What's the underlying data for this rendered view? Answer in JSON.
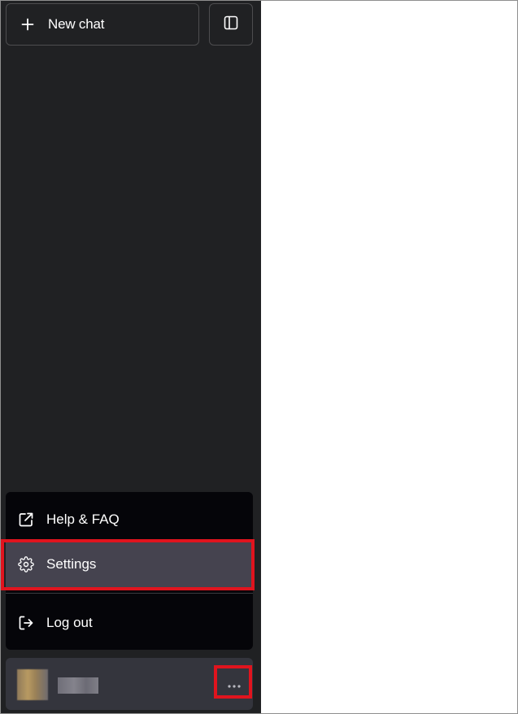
{
  "sidebar": {
    "new_chat_label": "New chat",
    "background_color": "#202123"
  },
  "menu": {
    "items": [
      {
        "label": "Help & FAQ",
        "icon": "external-link-icon"
      },
      {
        "label": "Settings",
        "icon": "gear-icon",
        "highlighted": true
      },
      {
        "label": "Log out",
        "icon": "logout-icon"
      }
    ],
    "highlight_color": "#e0141e"
  },
  "user": {
    "avatar": "blurred-avatar",
    "name": "",
    "more_icon": "ellipsis-icon"
  }
}
